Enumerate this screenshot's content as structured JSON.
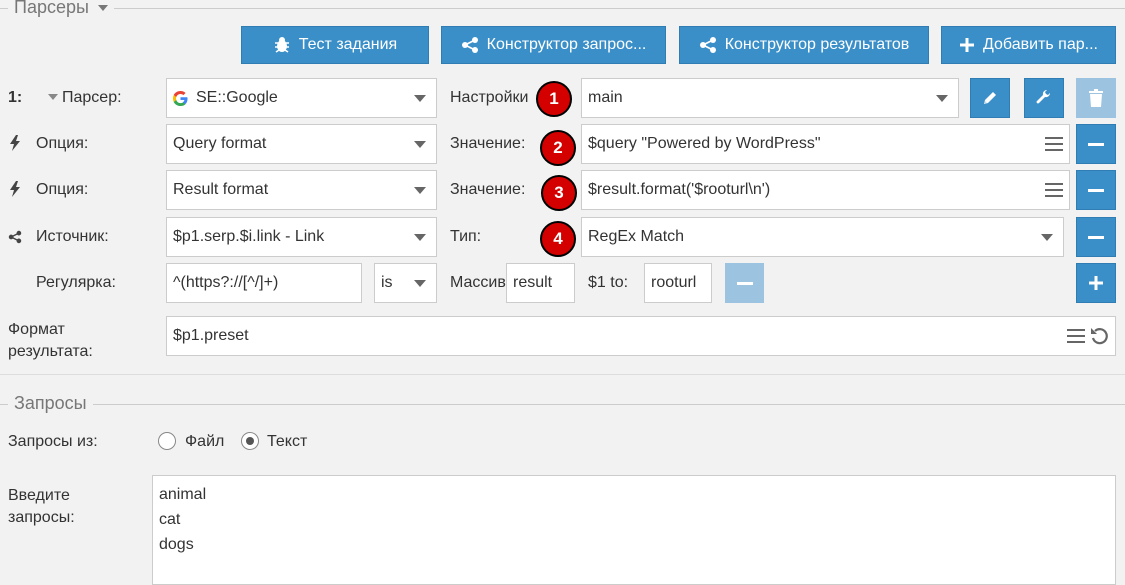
{
  "parsers_section": {
    "legend": "Парсеры",
    "buttons": {
      "test": "Тест задания",
      "query_builder": "Конструктор запрос...",
      "result_builder": "Конструктор результатов",
      "add_parser": "Добавить пар..."
    },
    "row_number": "1:",
    "parser_label": "Парсер:",
    "parser_value": "SE::Google",
    "settings_label": "Настройки",
    "settings_value": "main",
    "option1": {
      "label": "Опция:",
      "value": "Query format",
      "value_label": "Значение:",
      "value_text": "$query \"Powered by WordPress\""
    },
    "option2": {
      "label": "Опция:",
      "value": "Result format",
      "value_label": "Значение:",
      "value_text": "$result.format('$rooturl\\n')"
    },
    "source": {
      "label": "Источник:",
      "value": "$p1.serp.$i.link - Link",
      "type_label": "Тип:",
      "type_value": "RegEx Match"
    },
    "regex": {
      "label": "Регулярка:",
      "value": "^(https?://[^/]+)",
      "flags": "is",
      "array_label": "Массив",
      "array_value": "result",
      "to_label": "$1 to:",
      "to_value": "rooturl"
    },
    "result_format": {
      "label_line1": "Формат",
      "label_line2": "результата:",
      "value": "$p1.preset"
    },
    "badges": [
      "1",
      "2",
      "3",
      "4"
    ]
  },
  "queries_section": {
    "legend": "Запросы",
    "from_label": "Запросы из:",
    "option_file": "Файл",
    "option_text": "Текст",
    "enter_label_line1": "Введите",
    "enter_label_line2": "запросы:",
    "queries": "animal\ncat\ndogs"
  },
  "colors": {
    "accent": "#3a8fc8",
    "badge": "#d40000"
  },
  "icons": [
    "bug-icon",
    "share-icon",
    "plus-icon",
    "pencil-icon",
    "wrench-icon",
    "trash-icon",
    "bolt-icon",
    "menu-icon",
    "minus-icon",
    "undo-icon",
    "google-icon"
  ]
}
